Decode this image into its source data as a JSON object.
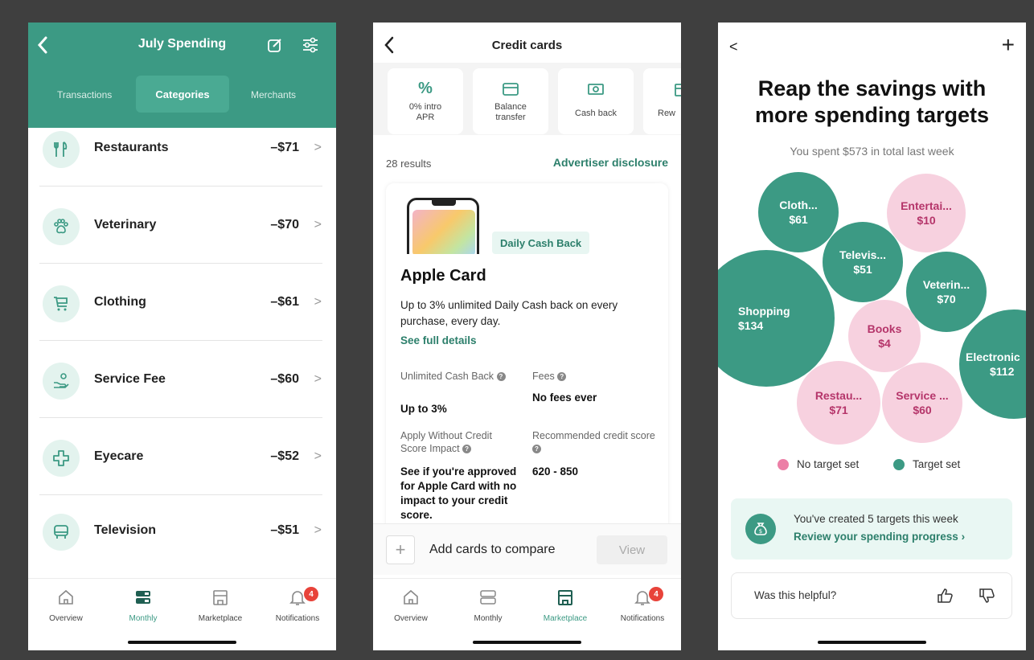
{
  "colors": {
    "accent": "#3c9a84",
    "target": "#3c9a84",
    "no_target": "#f7d1df",
    "badge": "#e8433a"
  },
  "screen1": {
    "title": "July Spending",
    "tabs": [
      "Transactions",
      "Categories",
      "Merchants"
    ],
    "active_tab": "Categories",
    "categories": [
      {
        "name": "Restaurants",
        "amount": "–$71",
        "icon": "utensils-icon"
      },
      {
        "name": "Veterinary",
        "amount": "–$70",
        "icon": "paw-icon"
      },
      {
        "name": "Clothing",
        "amount": "–$61",
        "icon": "cart-icon"
      },
      {
        "name": "Service Fee",
        "amount": "–$60",
        "icon": "hand-coin-icon"
      },
      {
        "name": "Eyecare",
        "amount": "–$52",
        "icon": "medical-cross-icon"
      },
      {
        "name": "Television",
        "amount": "–$51",
        "icon": "tv-icon"
      }
    ],
    "chevron": ">",
    "nav": {
      "items": [
        "Overview",
        "Monthly",
        "Marketplace",
        "Notifications"
      ],
      "active": "Monthly",
      "badge": "4"
    }
  },
  "screen2": {
    "title": "Credit cards",
    "card_types": [
      {
        "label": "0% intro\nAPR",
        "icon": "percent-icon"
      },
      {
        "label": "Balance\ntransfer",
        "icon": "card-icon"
      },
      {
        "label": "Cash back",
        "icon": "cash-icon"
      },
      {
        "label": "Rew",
        "icon": "gift-icon"
      }
    ],
    "results": "28 results",
    "advertiser": "Advertiser disclosure",
    "card": {
      "tag": "Daily Cash Back",
      "name": "Apple Card",
      "description": "Up to 3% unlimited Daily Cash back on every purchase, every day.",
      "details_link": "See full details",
      "f1_label": "Unlimited Cash Back",
      "f1_value": "Up to 3%",
      "f2_label": "Fees",
      "f2_value": "No fees ever",
      "f3_label": "Apply Without Credit Score Impact",
      "f3_value": "See if you're approved for Apple Card with no impact to your credit score.",
      "f4_label": "Recommended credit score",
      "f4_value": "620 - 850"
    },
    "compare": {
      "plus": "+",
      "label": "Add cards to compare",
      "button": "View"
    },
    "nav": {
      "items": [
        "Overview",
        "Monthly",
        "Marketplace",
        "Notifications"
      ],
      "active": "Marketplace",
      "badge": "4"
    }
  },
  "screen3": {
    "back": "<",
    "plus": "+",
    "headline": "Reap the savings with more spending targets",
    "subtitle": "You spent $573 in total last week",
    "bubbles": [
      {
        "label": "Cloth...",
        "value": "$61",
        "target": true
      },
      {
        "label": "Entertai...",
        "value": "$10",
        "target": false
      },
      {
        "label": "Televis...",
        "value": "$51",
        "target": true
      },
      {
        "label": "Veterin...",
        "value": "$70",
        "target": true
      },
      {
        "label": "Shopping",
        "value": "$134",
        "target": true
      },
      {
        "label": "Books",
        "value": "$4",
        "target": false
      },
      {
        "label": "Electronic",
        "value": "$112",
        "target": true
      },
      {
        "label": "Restau...",
        "value": "$71",
        "target": false
      },
      {
        "label": "Service ...",
        "value": "$60",
        "target": false
      }
    ],
    "legend": {
      "no_target": "No target set",
      "target": "Target set"
    },
    "progress": {
      "line1": "You've created 5 targets this week",
      "line2": "Review your spending progress",
      "chevron": "›"
    },
    "helpful": "Was this helpful?"
  }
}
